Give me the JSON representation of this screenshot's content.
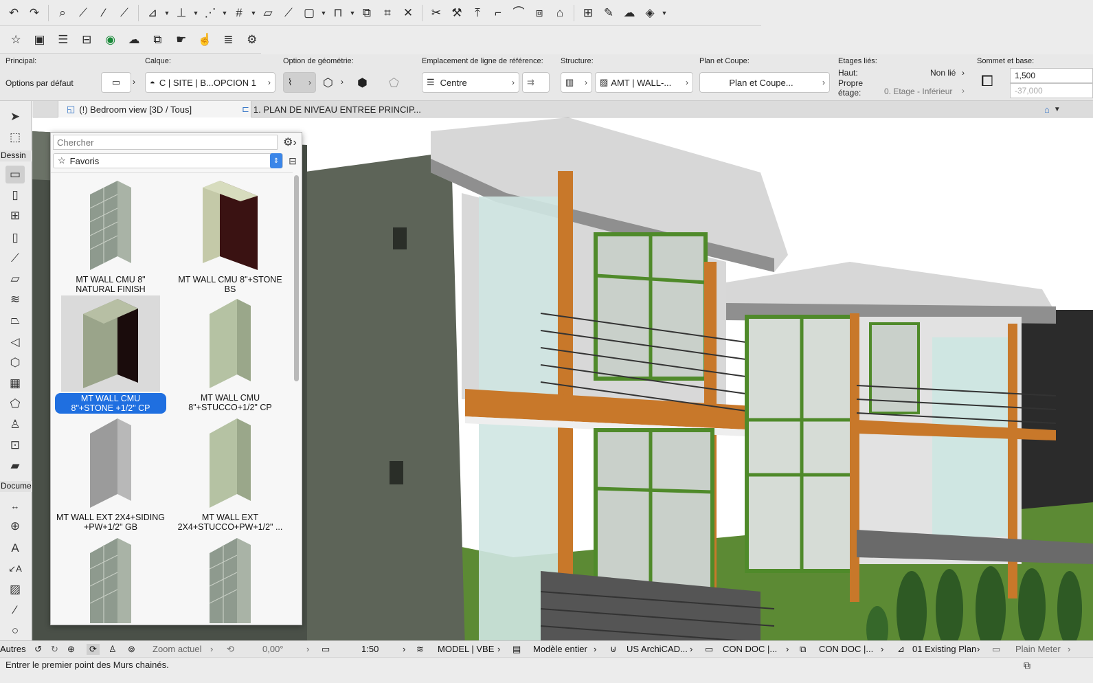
{
  "info_box": {
    "principal_label": "Principal:",
    "options_label": "Options par défaut",
    "calque_label": "Calque:",
    "calque_value": "C | SITE | B...OPCION 1",
    "geometry_label": "Option de géométrie:",
    "refline_label": "Emplacement de ligne de référence:",
    "refline_value": "Centre",
    "structure_label": "Structure:",
    "structure_value": "AMT | WALL-...",
    "plan_label": "Plan et Coupe:",
    "plan_value": "Plan et Coupe...",
    "etages_label": "Etages liés:",
    "haut_label": "Haut:",
    "haut_value": "Non lié",
    "propre_label": "Propre",
    "etage_label": "étage:",
    "etage_value": "0. Etage - Inférieur",
    "sommet_label": "Sommet et base:",
    "sommet_value": "1,500",
    "base_value": "-37,000"
  },
  "tabs": [
    {
      "label": "(!) Bedroom view [3D / Tous]"
    },
    {
      "label": "1. PLAN DE NIVEAU ENTREE PRINCIP..."
    }
  ],
  "toolbox": {
    "group_dessin": "Dessin",
    "group_document": "Docume",
    "group_autres": "Autres"
  },
  "palette": {
    "search_placeholder": "Chercher",
    "folder": "Favoris",
    "items": [
      {
        "label": "MT WALL CMU 8\" NATURAL FINISH"
      },
      {
        "label": "MT WALL CMU 8\"+STONE BS"
      },
      {
        "label": "MT WALL CMU 8\"+STONE +1/2\" CP"
      },
      {
        "label": "MT WALL CMU 8\"+STUCCO+1/2\" CP"
      },
      {
        "label": "MT WALL EXT 2X4+SIDING +PW+1/2\" GB"
      },
      {
        "label": "MT WALL EXT 2X4+STUCCO+PW+1/2\" ..."
      }
    ]
  },
  "status_bar": {
    "zoom_label": "Zoom actuel",
    "angle": "0,00°",
    "scale": "1:50",
    "model": "MODEL | VBE",
    "model_view": "Modèle entier",
    "pen_set": "US ArchiCAD...",
    "doc1": "CON DOC |...",
    "doc2": "CON DOC |...",
    "renovation": "01 Existing Plan",
    "units": "Plain Meter"
  },
  "prompt": "Entrer le premier point des Murs chainés.",
  "colors": {
    "accent": "#1f6fe0",
    "wall_green": "#5d6458",
    "timber": "#c8782a",
    "frame_green": "#4f8a2a",
    "glass": "#cfe6e2",
    "lawn": "#5c8a34"
  }
}
